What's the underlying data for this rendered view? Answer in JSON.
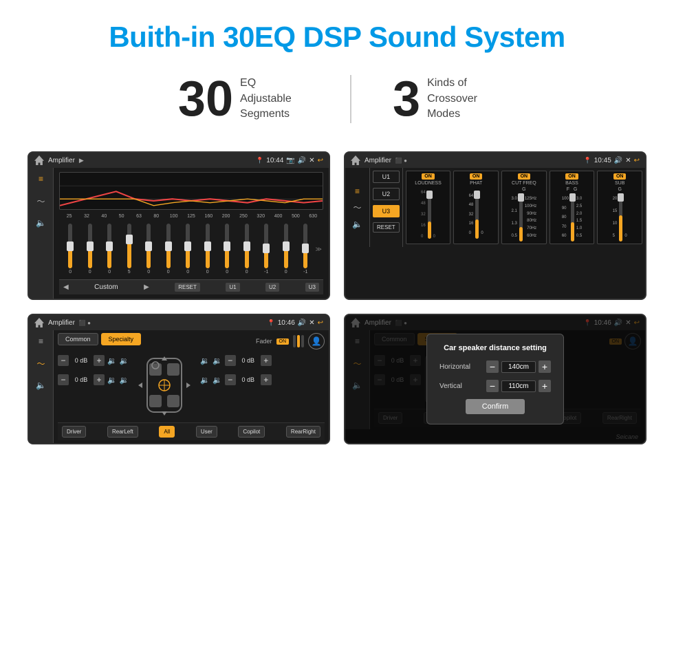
{
  "header": {
    "title": "Buith-in 30EQ DSP Sound System"
  },
  "stats": {
    "eq_number": "30",
    "eq_label_line1": "EQ Adjustable",
    "eq_label_line2": "Segments",
    "crossover_number": "3",
    "crossover_label_line1": "Kinds of",
    "crossover_label_line2": "Crossover Modes"
  },
  "screens": {
    "screen1": {
      "title": "Amplifier",
      "time": "10:44",
      "eq_freqs": [
        "25",
        "32",
        "40",
        "50",
        "63",
        "80",
        "100",
        "125",
        "160",
        "200",
        "250",
        "320",
        "400",
        "500",
        "630"
      ],
      "eq_values": [
        "0",
        "0",
        "0",
        "5",
        "0",
        "0",
        "0",
        "0",
        "0",
        "0",
        "-1",
        "0",
        "-1"
      ],
      "slider_heights": [
        50,
        50,
        52,
        65,
        48,
        50,
        52,
        50,
        52,
        50,
        45,
        50,
        45
      ],
      "preset_label": "Custom",
      "bottom_btns": [
        "RESET",
        "U1",
        "U2",
        "U3"
      ]
    },
    "screen2": {
      "title": "Amplifier",
      "time": "10:45",
      "channels": [
        "LOUDNESS",
        "PHAT",
        "CUT FREQ",
        "BASS",
        "SUB"
      ],
      "u_btns": [
        "U1",
        "U2",
        "U3"
      ],
      "u_active": "U3",
      "reset_label": "RESET"
    },
    "screen3": {
      "title": "Amplifier",
      "time": "10:46",
      "tabs": [
        "Common",
        "Specialty"
      ],
      "active_tab": "Specialty",
      "fader_label": "Fader",
      "fader_on": "ON",
      "db_values": [
        "0 dB",
        "0 dB",
        "0 dB",
        "0 dB"
      ],
      "bottom_btns": [
        "Driver",
        "RearLeft",
        "All",
        "User",
        "Copilot",
        "RearRight"
      ],
      "all_active": true
    },
    "screen4": {
      "title": "Amplifier",
      "time": "10:46",
      "tabs": [
        "Common",
        "Specialty"
      ],
      "active_tab": "Specialty",
      "dialog": {
        "title": "Car speaker distance setting",
        "horizontal_label": "Horizontal",
        "horizontal_value": "140cm",
        "vertical_label": "Vertical",
        "vertical_value": "110cm",
        "confirm_label": "Confirm"
      },
      "bottom_btns": [
        "Driver",
        "RearLeft",
        "All",
        "User",
        "Copilot",
        "RearRight"
      ]
    }
  },
  "brand": "Seicane"
}
